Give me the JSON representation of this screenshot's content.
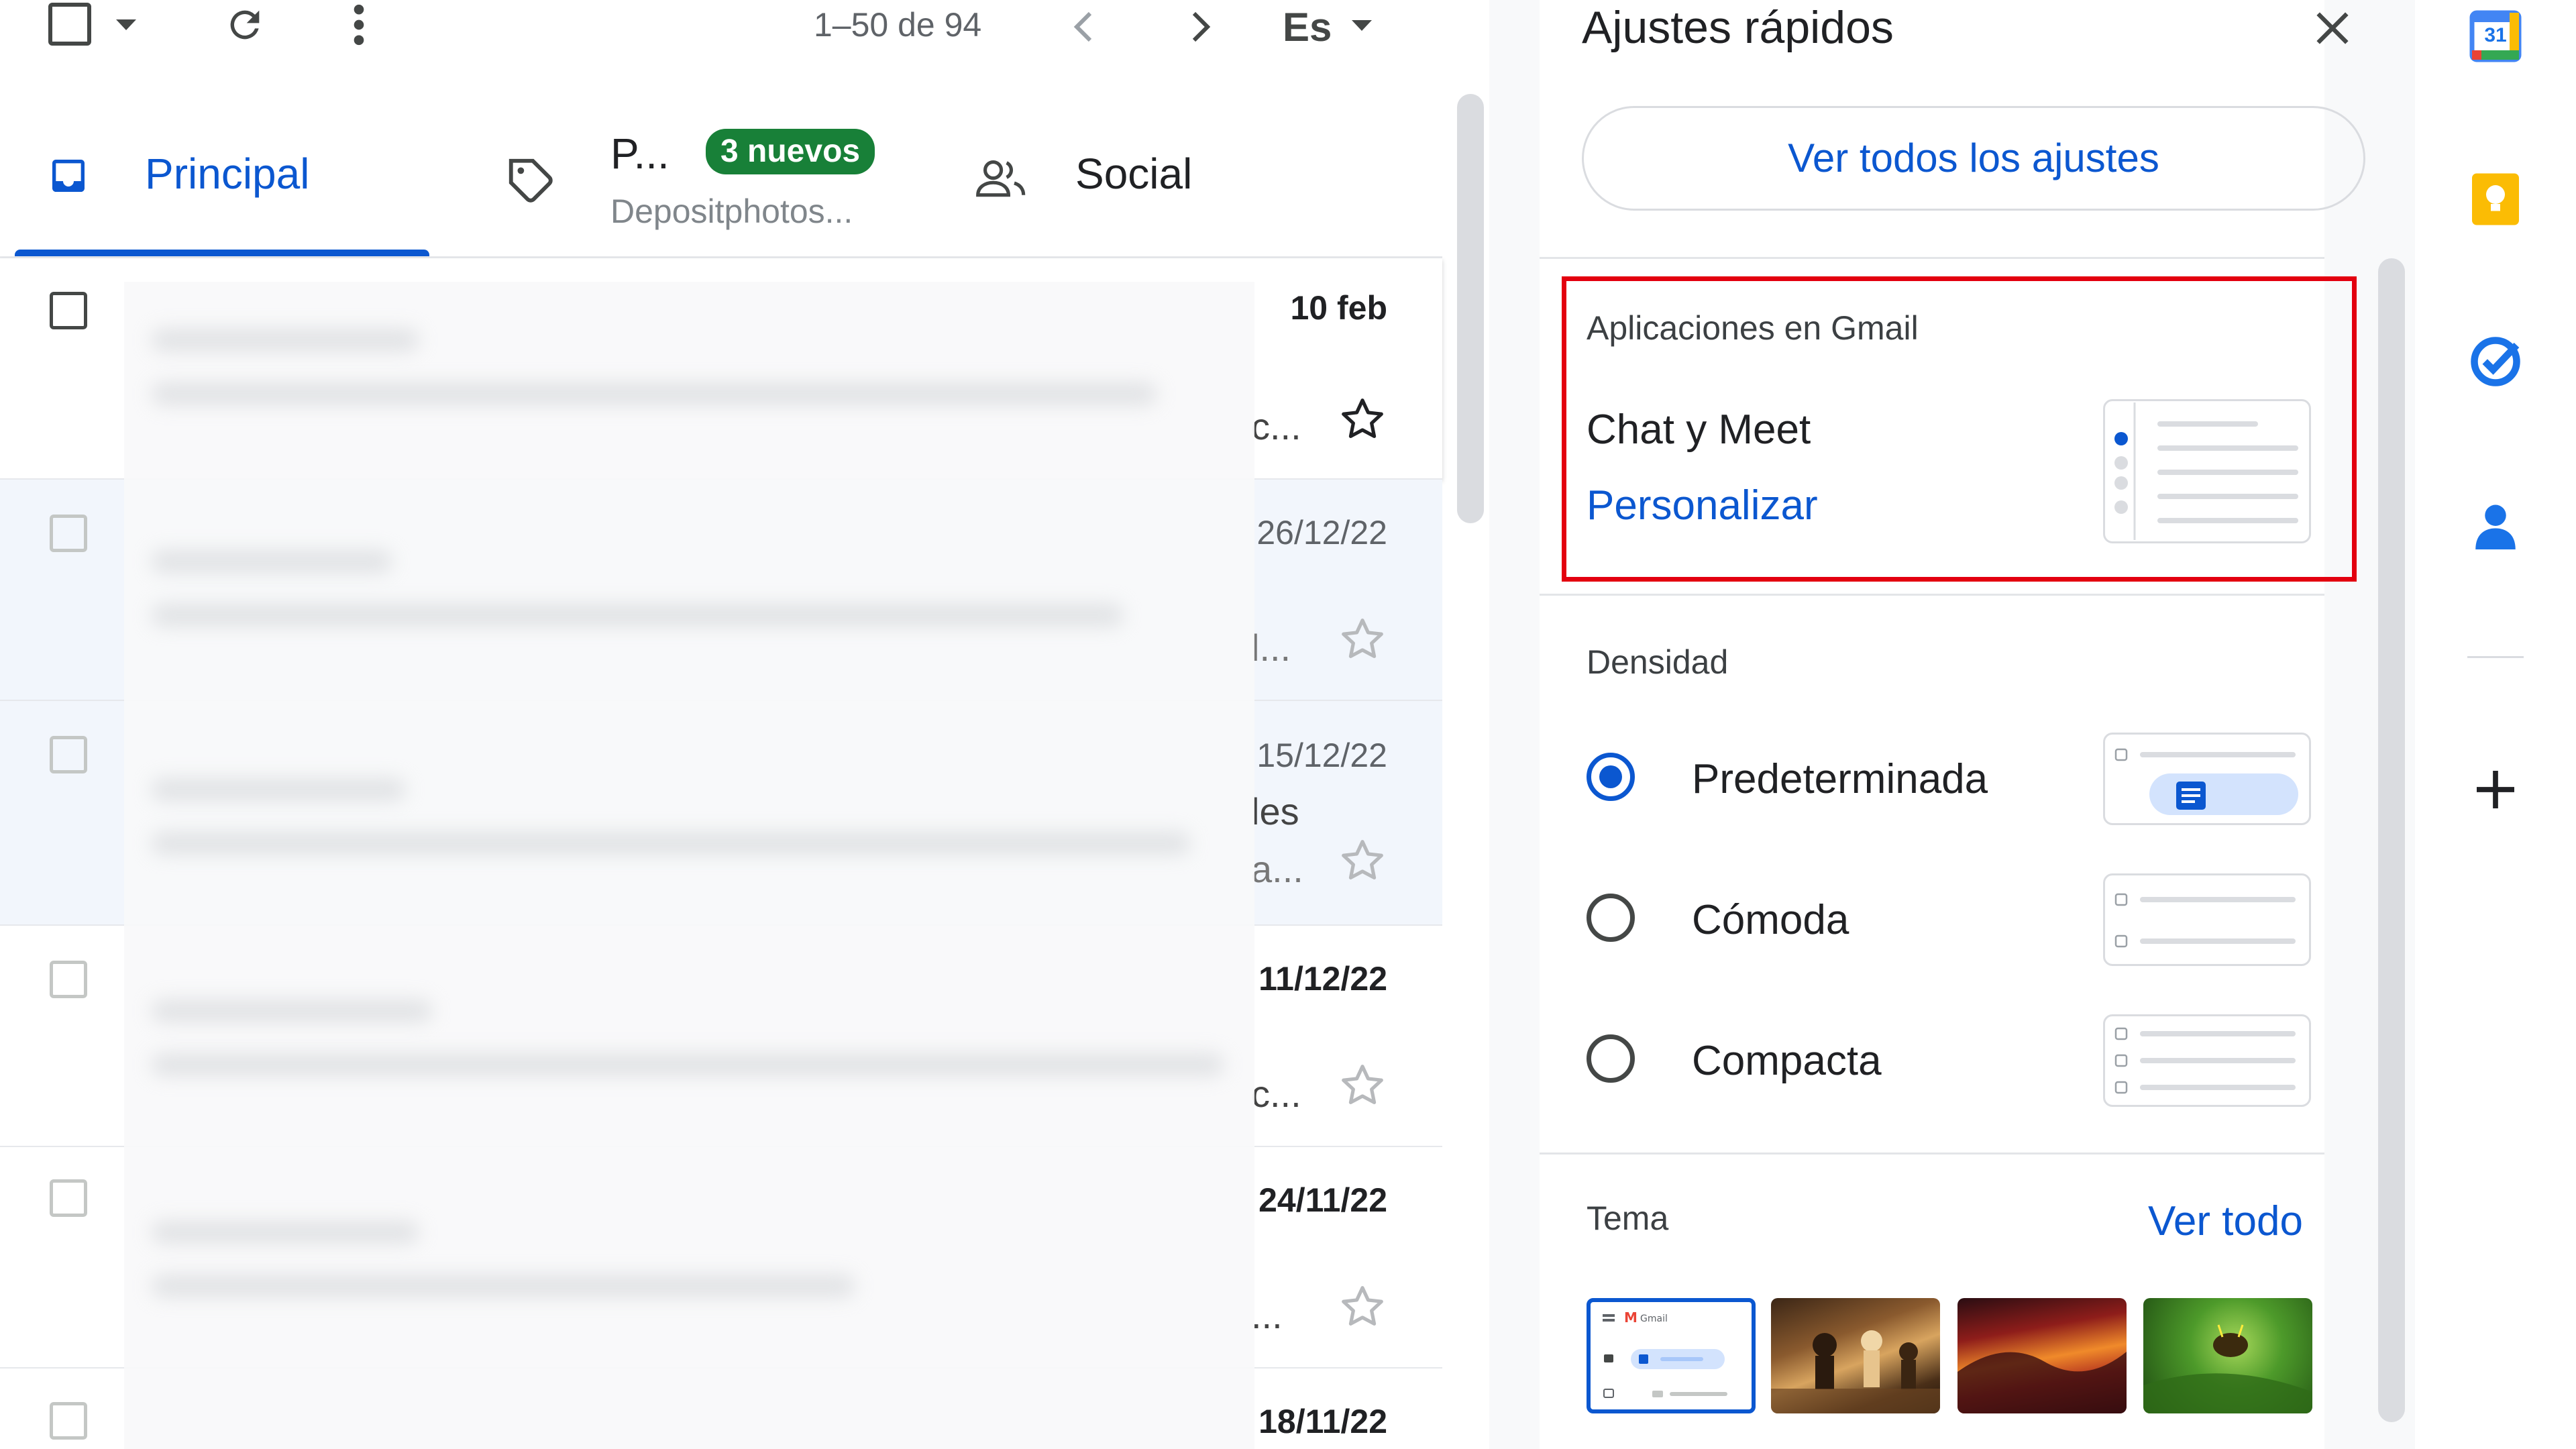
{
  "toolbar": {
    "pagination": "1–50 de 94",
    "language": "Es"
  },
  "tabs": [
    {
      "label": "Principal",
      "active": true
    },
    {
      "label": "P...",
      "badge": "3 nuevos",
      "sub": "Depositphotos..."
    },
    {
      "label": "Social"
    }
  ],
  "rows": [
    {
      "date": "10 feb",
      "unread": true,
      "fragment": "c..."
    },
    {
      "date": "26/12/22",
      "unread": false,
      "fragment": "l..."
    },
    {
      "date": "15/12/22",
      "unread": false,
      "fragment": "les",
      "fragment2": "a..."
    },
    {
      "date": "11/12/22",
      "unread": true,
      "fragment": "c..."
    },
    {
      "date": "24/11/22",
      "unread": true,
      "fragment": "..."
    },
    {
      "date": "18/11/22",
      "unread": true,
      "fragment": ""
    }
  ],
  "quick_settings": {
    "title": "Ajustes rápidos",
    "see_all": "Ver todos los ajustes",
    "apps": {
      "heading": "Aplicaciones en Gmail",
      "item": "Chat y Meet",
      "customize": "Personalizar"
    },
    "density": {
      "heading": "Densidad",
      "options": [
        {
          "label": "Predeterminada",
          "selected": true
        },
        {
          "label": "Cómoda",
          "selected": false
        },
        {
          "label": "Compacta",
          "selected": false
        }
      ]
    },
    "theme": {
      "heading": "Tema",
      "see_all": "Ver todo",
      "default_tile_text": "Gmail"
    }
  },
  "rail": {
    "calendar_day": "31"
  },
  "colors": {
    "accent": "#0b57d0",
    "badge": "#188038",
    "highlight_box": "#e3000f"
  }
}
